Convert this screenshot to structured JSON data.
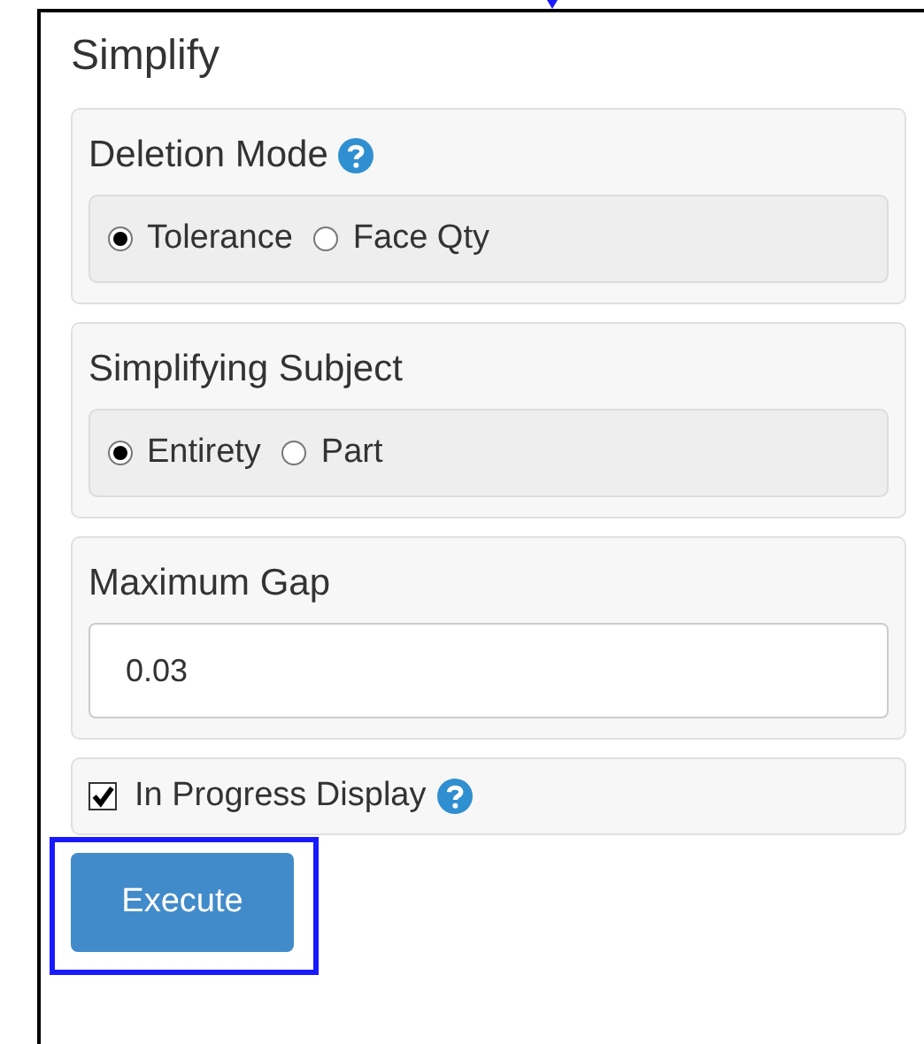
{
  "panel": {
    "title": "Simplify"
  },
  "sections": [
    {
      "kind": "radio",
      "label": "Deletion Mode",
      "help": true,
      "options": [
        {
          "label": "Tolerance",
          "selected": true
        },
        {
          "label": "Face Qty",
          "selected": false
        }
      ]
    },
    {
      "kind": "radio",
      "label": "Simplifying Subject",
      "help": false,
      "options": [
        {
          "label": "Entirety",
          "selected": true
        },
        {
          "label": "Part",
          "selected": false
        }
      ]
    },
    {
      "kind": "input",
      "label": "Maximum Gap",
      "value": "0.03"
    },
    {
      "kind": "checkbox",
      "label": "In Progress Display",
      "checked": true,
      "help": true
    }
  ],
  "button": {
    "label": "Execute",
    "highlighted": true
  }
}
